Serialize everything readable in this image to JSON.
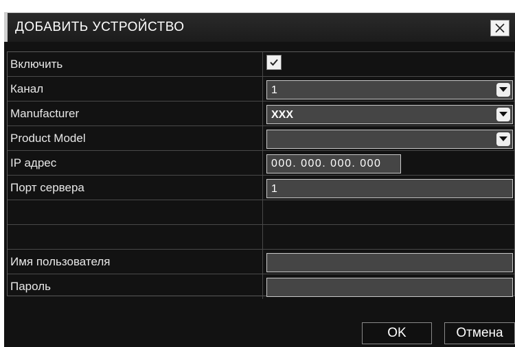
{
  "dialog": {
    "title": "ДОБАВИТЬ УСТРОЙСТВО",
    "close_icon": "close-icon"
  },
  "rows": [
    {
      "label": "Включить",
      "type": "checkbox",
      "checked": true
    },
    {
      "label": "Канал",
      "type": "select",
      "value": "1"
    },
    {
      "label": "Manufacturer",
      "type": "select",
      "value": "XXX"
    },
    {
      "label": "Product Model",
      "type": "select",
      "value": ""
    },
    {
      "label": "IP адрес",
      "type": "ip",
      "value": "000. 000. 000. 000"
    },
    {
      "label": "Порт сервера",
      "type": "text",
      "value": "1"
    },
    {
      "label": "",
      "type": "empty"
    },
    {
      "label": "",
      "type": "empty"
    },
    {
      "label": "Имя пользователя",
      "type": "text",
      "value": ""
    },
    {
      "label": "Пароль",
      "type": "text",
      "value": ""
    }
  ],
  "buttons": {
    "ok": "OK",
    "cancel": "Отмена"
  },
  "colors": {
    "background": "#121212",
    "field": "#454545",
    "text": "#ffffff"
  }
}
